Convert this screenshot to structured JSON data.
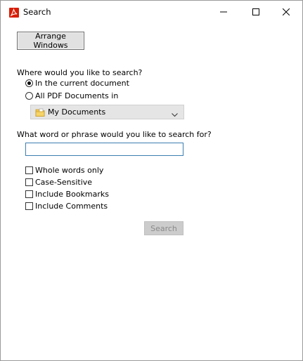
{
  "window": {
    "title": "Search",
    "icon": "acrobat-icon",
    "controls": [
      "minimize-icon",
      "maximize-icon",
      "close-icon"
    ]
  },
  "toolbar": {
    "arrange_label": "Arrange Windows"
  },
  "scope": {
    "question": "Where would you like to search?",
    "options": [
      {
        "label": "In the current document",
        "selected": true
      },
      {
        "label": "All PDF Documents in",
        "selected": false
      }
    ],
    "location": {
      "selected": "My Documents",
      "icon": "folder-icon"
    }
  },
  "query": {
    "question": "What word or phrase would you like to search for?",
    "value": "",
    "placeholder": ""
  },
  "options": [
    {
      "label": "Whole words only",
      "checked": false
    },
    {
      "label": "Case-Sensitive",
      "checked": false
    },
    {
      "label": "Include Bookmarks",
      "checked": false
    },
    {
      "label": "Include Comments",
      "checked": false
    }
  ],
  "actions": {
    "search_label": "Search",
    "search_enabled": false
  },
  "colors": {
    "brand": "#d81e05",
    "input_border": "#3c7fb1",
    "disabled_text": "#8a8a8a"
  }
}
